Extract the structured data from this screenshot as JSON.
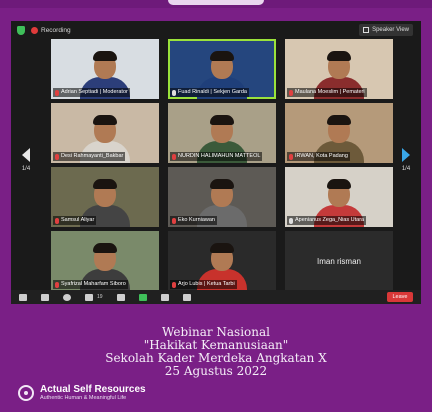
{
  "zoom": {
    "recording_label": "Recording",
    "speaker_view_label": "Speaker View",
    "page_indicator_left": "1/4",
    "page_indicator_right": "1/4",
    "participant_count": "19",
    "leave_label": "Leave",
    "participants": [
      {
        "name": "Adrian Septiadi | Moderator",
        "muted": true,
        "active": false,
        "bg": "#d8dde2",
        "shirt": "#2c3e7a"
      },
      {
        "name": "Fuad Rinaldi | Sekjen Garda",
        "muted": false,
        "active": true,
        "bg": "#25467e",
        "shirt": "#1f3f7a"
      },
      {
        "name": "Maulana Moeslim | Pemateri",
        "muted": true,
        "active": false,
        "bg": "#d7c7b1",
        "shirt": "#8a2d2d"
      },
      {
        "name": "Desi Rahmayanti_Bakbar",
        "muted": true,
        "active": false,
        "bg": "#c9b9a5",
        "shirt": "#d9d4cc"
      },
      {
        "name": "NURDIN HALIMAHUN MATTEOL",
        "muted": true,
        "active": false,
        "bg": "#a9a088",
        "shirt": "#3b5a3a"
      },
      {
        "name": "IRWAN, Kota Padang",
        "muted": true,
        "active": false,
        "bg": "#b59a7a",
        "shirt": "#6d5a3a"
      },
      {
        "name": "Samsul Aliyar",
        "muted": true,
        "active": false,
        "bg": "#6c6a4f",
        "shirt": "#444"
      },
      {
        "name": "Eko Kurniawan",
        "muted": true,
        "active": false,
        "bg": "#5d5a55",
        "shirt": "#6b6b6b"
      },
      {
        "name": "Apenianus Zega_Nias Utara",
        "muted": false,
        "active": false,
        "bg": "#d6d1c8",
        "shirt": "#c43a3a"
      },
      {
        "name": "Syafrizal Maharfam Siboro",
        "muted": true,
        "active": false,
        "bg": "#7a8a6a",
        "shirt": "#3d3d3d"
      },
      {
        "name": "Arjo Lubis | Ketua Tarbi",
        "muted": true,
        "active": false,
        "bg": "#2a2a2a",
        "shirt": "#c8322c"
      },
      {
        "name": "Iman risman",
        "muted": true,
        "active": false,
        "blank": true
      }
    ]
  },
  "caption": {
    "line1": "Webinar Nasional",
    "line2": "\"Hakikat Kemanusiaan\"",
    "line3": "Sekolah Kader Merdeka Angkatan X",
    "line4": "25 Agustus 2022"
  },
  "brand": {
    "name": "Actual Self Resources",
    "tagline": "Authentic Human & Meaningful Life"
  },
  "colors": {
    "background": "#7a1f86",
    "active_speaker": "#9be23b",
    "leave": "#d93838"
  }
}
